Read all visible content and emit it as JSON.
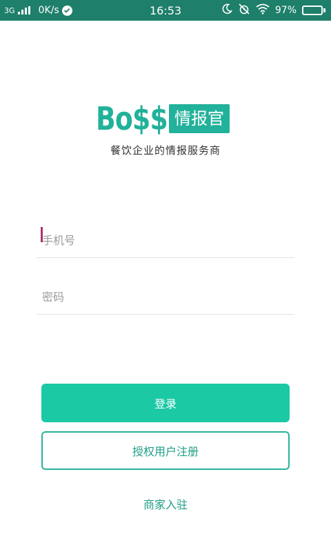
{
  "status_bar": {
    "network_type": "3G",
    "data_speed": "0K/s",
    "time": "16:53",
    "battery_percent": "97%",
    "battery_level": 0.97,
    "background_color": "#1e7f6a"
  },
  "logo": {
    "word": "Bo$$",
    "box_text": "情报官",
    "tagline": "餐饮企业的情报服务商",
    "brand_color": "#22b19a"
  },
  "form": {
    "phone_placeholder": "手机号",
    "phone_value": "",
    "password_placeholder": "密码",
    "password_value": ""
  },
  "actions": {
    "login_label": "登录",
    "register_label": "授权用户注册",
    "merchant_label": "商家入驻",
    "accent_color": "#1bc9a5"
  }
}
